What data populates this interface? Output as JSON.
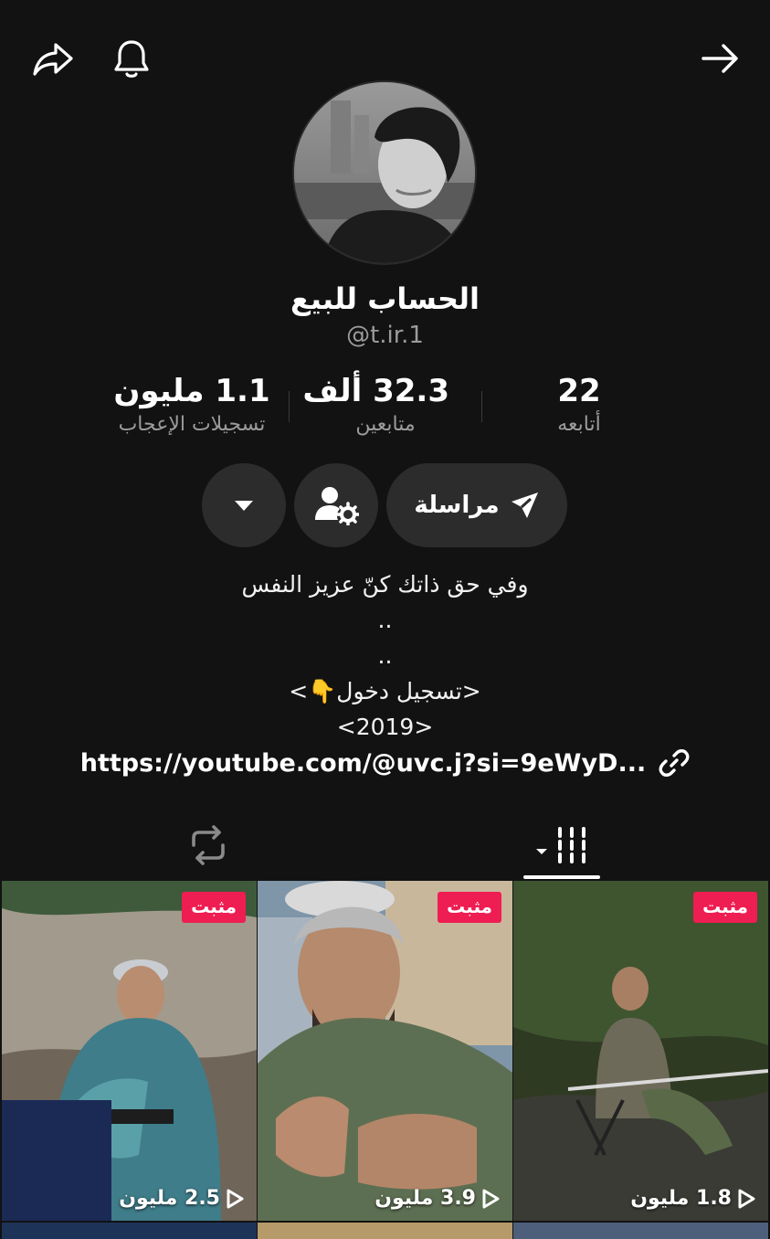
{
  "header": {
    "share_icon": "share-icon",
    "bell_icon": "bell-icon",
    "back_icon": "arrow-right-icon"
  },
  "profile": {
    "display_name": "الحساب للبيع",
    "handle": "@t.ir.1"
  },
  "stats": {
    "following": {
      "value": "22",
      "label": "أتابعه"
    },
    "followers": {
      "value": "32.3 ألف",
      "label": "متابعين"
    },
    "likes": {
      "value": "1.1 مليون",
      "label": "تسجيلات الإعجاب"
    }
  },
  "actions": {
    "message_label": "مراسلة",
    "friend_settings_icon": "user-gear-icon",
    "more_icon": "caret-down-icon"
  },
  "bio": {
    "lines": [
      "وفي حق ذاتك كنّ عزيز النفس",
      "..",
      "..",
      "<تسجيل دخول👇>",
      "<2019>"
    ],
    "link": "https://youtube.com/@uvc.j?si=9eWyD..."
  },
  "tabs": {
    "videos_icon": "grid-icon",
    "reposts_icon": "repost-icon"
  },
  "videos": [
    {
      "pinned_label": "مثبت",
      "views": "2.5 مليون"
    },
    {
      "pinned_label": "مثبت",
      "views": "3.9 مليون"
    },
    {
      "pinned_label": "مثبت",
      "views": "1.8 مليون"
    }
  ],
  "colors": {
    "background": "#121212",
    "button": "#2c2c2c",
    "pinned_badge": "#ee1d52",
    "secondary_text": "#9b9b9b"
  }
}
